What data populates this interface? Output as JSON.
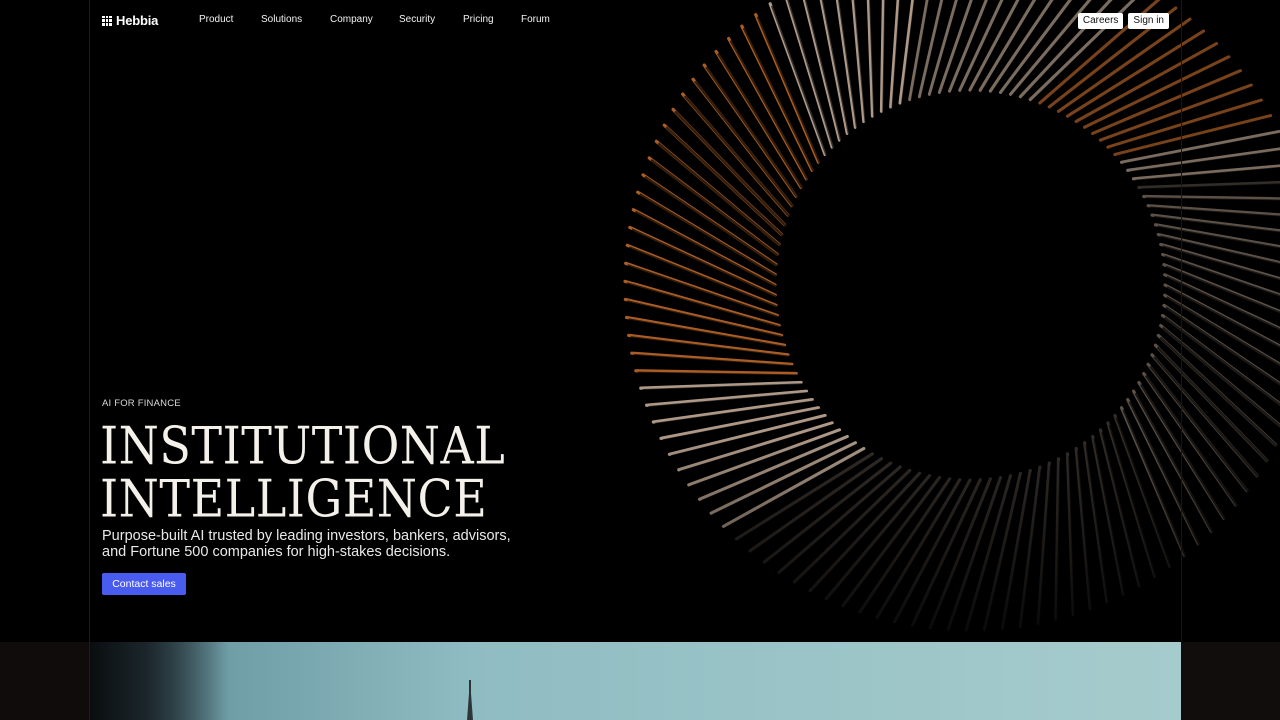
{
  "nav": {
    "logo_text": "Hebbia",
    "links": [
      "Product",
      "Solutions",
      "Company",
      "Security",
      "Pricing",
      "Forum"
    ],
    "careers_label": "Careers",
    "signin_label": "Sign in"
  },
  "hero": {
    "eyebrow": "AI FOR FINANCE",
    "headline_line1": "INSTITUTIONAL",
    "headline_line2": "INTELLIGENCE",
    "subtitle": "Purpose-built AI trusted by leading investors, bankers, advisors, and Fortune 500 companies for high-stakes decisions.",
    "cta_label": "Contact sales"
  },
  "colors": {
    "accent": "#4a5cf0",
    "background": "#000000",
    "turbine_copper": "#b8612a"
  }
}
